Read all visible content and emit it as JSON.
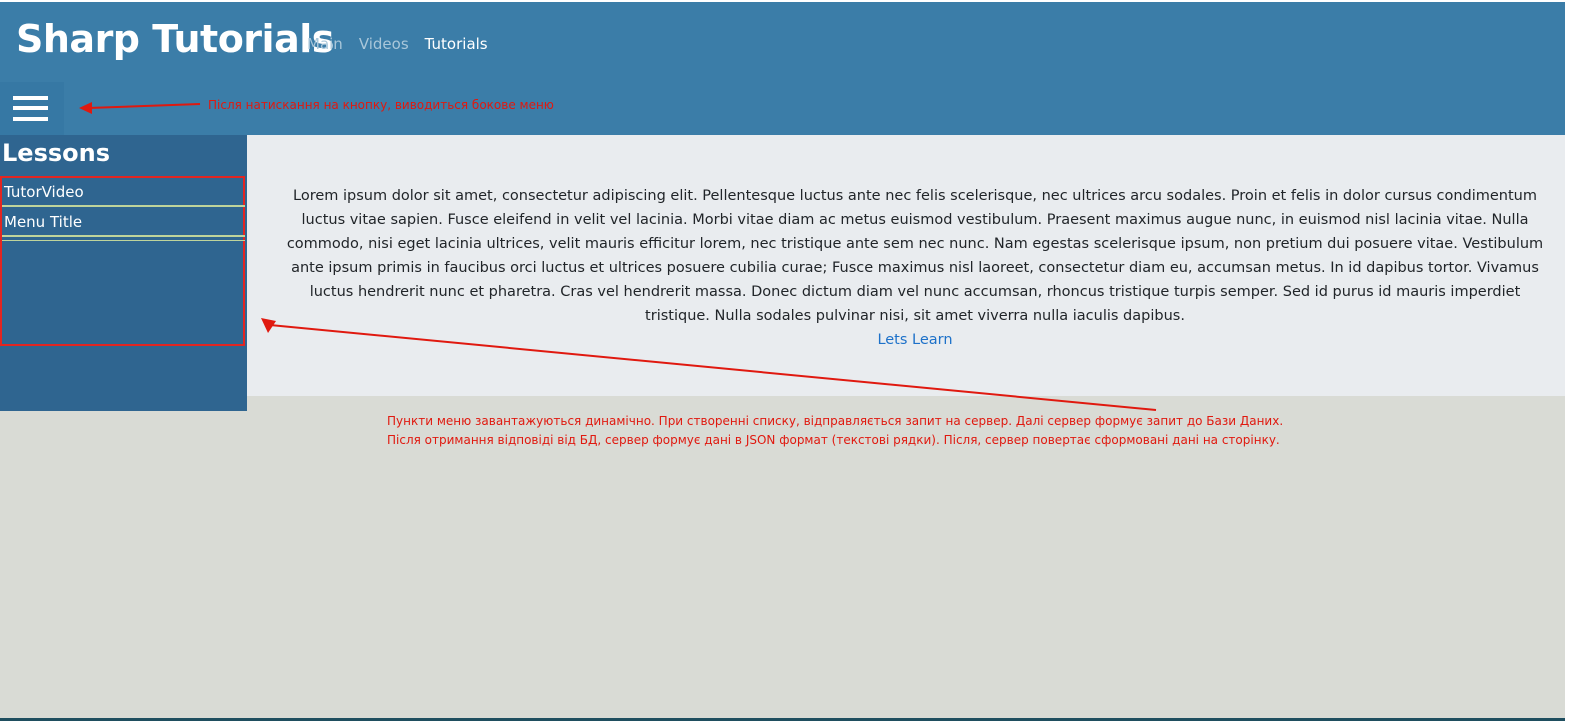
{
  "header": {
    "brand": "Sharp Tutorials",
    "nav": [
      {
        "label": "Main",
        "active": false
      },
      {
        "label": "Videos",
        "active": false
      },
      {
        "label": "Tutorials",
        "active": true
      }
    ],
    "menu_toggle_icon": "hamburger-menu-icon"
  },
  "sidebar": {
    "title": "Lessons",
    "items": [
      {
        "label": "TutorVideo"
      },
      {
        "label": "Menu Title"
      }
    ]
  },
  "main": {
    "body_text": "Lorem ipsum dolor sit amet, consectetur adipiscing elit. Pellentesque luctus ante nec felis scelerisque, nec ultrices arcu sodales. Proin et felis in dolor cursus condimentum luctus vitae sapien. Fusce eleifend in velit vel lacinia. Morbi vitae diam ac metus euismod vestibulum. Praesent maximus augue nunc, in euismod nisl lacinia vitae. Nulla commodo, nisi eget lacinia ultrices, velit mauris efficitur lorem, nec tristique ante sem nec nunc. Nam egestas scelerisque ipsum, non pretium dui posuere vitae. Vestibulum ante ipsum primis in faucibus orci luctus et ultrices posuere cubilia curae; Fusce maximus nisl laoreet, consectetur diam eu, accumsan metus. In id dapibus tortor. Vivamus luctus hendrerit nunc et pharetra. Cras vel hendrerit massa. Donec dictum diam vel nunc accumsan, rhoncus tristique turpis semper. Sed id purus id mauris imperdiet tristique. Nulla sodales pulvinar nisi, sit amet viverra nulla iaculis dapibus.",
    "link_label": "Lets Learn"
  },
  "annotations": {
    "hamburger_note": "Після натискання на кнопку, виводиться бокове меню",
    "menu_note_line1": "Пункти меню завантажуються динамічно. При створенні списку, відправляється запит на сервер. Далі сервер формує запит до Бази Даних.",
    "menu_note_line2": "Після отримання відповіді від БД, сервер формує дані в JSON формат (текстові рядки). Після, сервер повертає сформовані дані на сторінку."
  },
  "colors": {
    "header_bg": "#3b7da8",
    "sidebar_bg": "#2f6590",
    "content_bg": "#e9ecef",
    "page_bg": "#d9dbd5",
    "annotation": "#e0190f",
    "link": "#1d71c9"
  }
}
